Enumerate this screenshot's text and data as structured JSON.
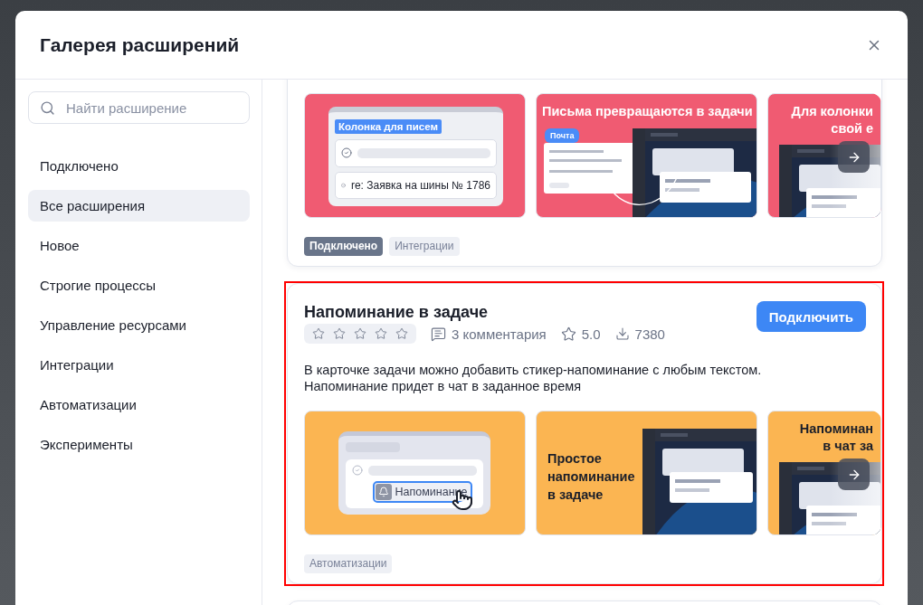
{
  "dialog": {
    "title": "Галерея расширений"
  },
  "search": {
    "placeholder": "Найти расширение"
  },
  "sidebar": {
    "items": [
      {
        "label": "Подключено",
        "selected": false
      },
      {
        "label": "Все расширения",
        "selected": true
      },
      {
        "label": "Новое",
        "selected": false
      },
      {
        "label": "Строгие процессы",
        "selected": false
      },
      {
        "label": "Управление ресурсами",
        "selected": false
      },
      {
        "label": "Интеграции",
        "selected": false
      },
      {
        "label": "Автоматизации",
        "selected": false
      },
      {
        "label": "Эксперименты",
        "selected": false
      }
    ]
  },
  "extensions": [
    {
      "highlighted": false,
      "color": "#f05b72",
      "slides": [
        {
          "kind": "list",
          "label": "Колонка для писем",
          "rows": [
            "",
            "re: Заявка на шины № 1786"
          ]
        },
        {
          "kind": "screens",
          "title": "Письма превращаются в задачи",
          "badge": "Почта"
        },
        {
          "kind": "teaser",
          "lines": [
            "Для колонки",
            "свой е"
          ]
        }
      ],
      "tags": [
        {
          "label": "Подключено",
          "kind": "status"
        },
        {
          "label": "Интеграции",
          "kind": "category"
        }
      ]
    },
    {
      "highlighted": true,
      "color": "#fbb552",
      "title": "Напоминание в задаче",
      "button": "Подключить",
      "stars": 0,
      "comments": "3 комментария",
      "rating": "5.0",
      "installs": "7380",
      "description": "В карточке задачи можно добавить стикер-напоминание с любым текстом.\nНапоминание придет в чат в заданное время",
      "slides": [
        {
          "kind": "reminder",
          "label": "Напоминание"
        },
        {
          "kind": "caption",
          "lines": [
            "Простое",
            "напоминание",
            "в задаче"
          ]
        },
        {
          "kind": "teaser",
          "lines": [
            "Напоминан",
            "в чат за"
          ]
        }
      ],
      "tags": [
        {
          "label": "Автоматизации",
          "kind": "category"
        }
      ]
    }
  ]
}
